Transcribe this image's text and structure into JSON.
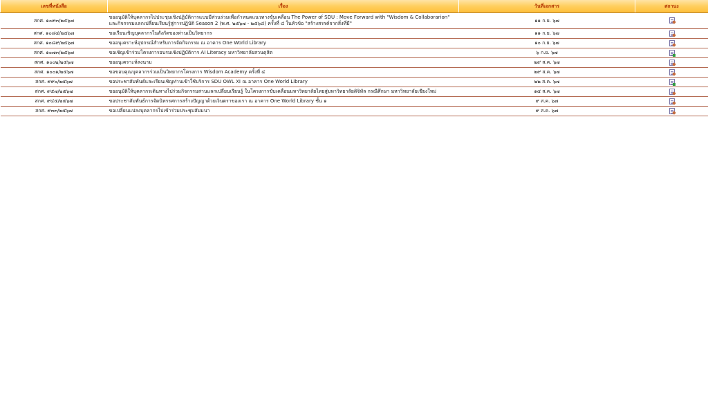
{
  "table": {
    "headers": {
      "doc_no": "เลขที่หนังสือ",
      "subject": "เรื่อง",
      "doc_date": "วันที่เอกสาร",
      "status": "สถานะ"
    },
    "rows": [
      {
        "doc_no": "สกศ. ๑๐๙๓/๒๕๖๗",
        "subject_lines": [
          "ขออนุมัติให้บุคลากรไปประชุมเชิงปฏิบัติการแบบมีส่วนร่วมเพื่อกำหนดแนวทางขับเคลื่อน The Power of SDU : Move Forward with \"Wisdom & Collaborarion\"",
          "และกิจกรรมแลกเปลี่ยนเรียนรู้สู่การปฏิบัติ Season 2 (พ.ศ. ๒๕๖๗ - ๒๕๖๘) ครั้งที่ ๔ ในหัวข้อ \"สร้างสรรค์จากสิ่งที่มี\""
        ],
        "doc_date": "๑๑ ก.ย. ๖๗",
        "status_icon": "document-pending-icon"
      },
      {
        "doc_no": "สกศ. ๑๐๘๔/๒๕๖๗",
        "subject_lines": [
          "ขอเรียนเชิญบุคลากรในสังกัดของท่านเป็นวิทยากร"
        ],
        "doc_date": "๑๑ ก.ย. ๖๗",
        "status_icon": "document-pending-icon"
      },
      {
        "doc_no": "สกศ. ๑๐๘๙/๒๕๖๗",
        "subject_lines": [
          "ขออนุเคราะห์อุปกรณ์สำหรับการจัดกิจกรรม ณ อาคาร One World Library"
        ],
        "doc_date": "๑๐ ก.ย. ๖๗",
        "status_icon": "document-pending-icon"
      },
      {
        "doc_no": "สกศ. ๑๐๗๓/๒๕๖๗",
        "subject_lines": [
          "ขอเชิญเข้าร่วมโครงการอบรมเชิงปฏิบัติการ AI Literacy มหาวิทยาลัยสวนดุสิต"
        ],
        "doc_date": "๖ ก.ย. ๖๗",
        "status_icon": "document-done-icon"
      },
      {
        "doc_no": "สกศ. ๑๐๐๒/๒๕๖๗",
        "subject_lines": [
          "ขออนุเคราะห์ลงนาม"
        ],
        "doc_date": "๒๙ ส.ค. ๖๗",
        "status_icon": "document-pending-icon"
      },
      {
        "doc_no": "สกศ. ๑๐๐๑/๒๕๖๗",
        "subject_lines": [
          "ขอขอบคุณบุคลากรร่วมเป็นวิทยากรโครงการ Wisdom Academy ครั้งที่ ๔"
        ],
        "doc_date": "๒๙ ส.ค. ๖๗",
        "status_icon": "document-pending-icon"
      },
      {
        "doc_no": "สกศ. ๙๙๐/๒๕๖๗",
        "subject_lines": [
          "ขอประชาสัมพันธ์และเรียนเชิญท่านเข้าใช้บริการ SDU OWL XI ณ อาคาร One World Library"
        ],
        "doc_date": "๒๒ ส.ค. ๖๗",
        "status_icon": "document-done-icon"
      },
      {
        "doc_no": "สกศ. ๙๕๗/๒๕๖๗",
        "subject_lines": [
          "ขออนุมัติให้บุคลากรเดินทางไปร่วมกิจกรรมสานแลกเปลี่ยนเรียนรู้ ในโครงการขับเคลื่อนมหาวิทยาลัยไทยสู่มหาวิทยาลัยดิจิทัล กรณีศึกษา มหาวิทยาลัยเชียงใหม่"
        ],
        "doc_date": "๑๕ ส.ค. ๖๗",
        "status_icon": "document-pending-icon"
      },
      {
        "doc_no": "สกศ. ๙๔๕/๒๕๖๗",
        "subject_lines": [
          "ขอประชาสัมพันธ์การจัดนิทรรศการสร้างปัญญาด้วยเงินตราของเรา ณ อาคาร One World Library ชั้น ๑"
        ],
        "doc_date": "๙ ส.ค. ๖๗",
        "status_icon": "document-pending-icon"
      },
      {
        "doc_no": "สกศ. ๙๓๓/๒๕๖๗",
        "subject_lines": [
          "ขอเปลี่ยนแปลงบุคลากรไปเข้าร่วมประชุมสัมมนา"
        ],
        "doc_date": "๙ ส.ค. ๖๗",
        "status_icon": "document-pending-icon"
      }
    ]
  }
}
